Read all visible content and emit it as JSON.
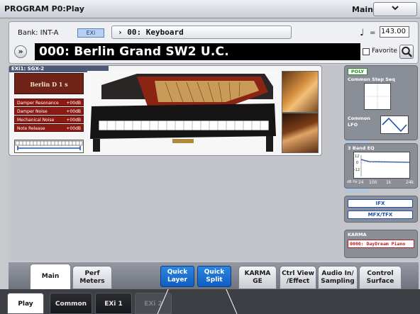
{
  "title_bar": {
    "title": "PROGRAM P0:Play",
    "mode_label": "Main",
    "mode_button_glyph": "⌄"
  },
  "program": {
    "bank_label": "Bank:  INT-A",
    "exi_tag": "EXi",
    "program_select": "› 00: Keyboard",
    "tempo_icon": "♩",
    "tempo_eq": "=",
    "tempo_value": "143.00",
    "prev_glyph": "»",
    "program_name": "000: Berlin Grand SW2 U.C.",
    "favorite_label": "Favorite",
    "favorite_checked": false
  },
  "exi_panel": {
    "header": "EXi1: SGX-2",
    "plate": "Berlin D 1 s",
    "params": [
      {
        "name": "Damper Resonance",
        "value": "+00dB"
      },
      {
        "name": "Damper Noise",
        "value": "+00dB"
      },
      {
        "name": "Mechanical Noise",
        "value": "+00dB"
      },
      {
        "name": "Note Release",
        "value": "+00dB"
      }
    ]
  },
  "right_panel": {
    "poly_label": "POLY",
    "step_seq_label": "Common Step Seq",
    "lfo_label_1": "Common",
    "lfo_label_2": "LFO",
    "eq_title": "3 Band EQ",
    "eq_y_ticks": [
      "12",
      "0",
      "-12"
    ],
    "eq_x_ticks": [
      "24",
      "100",
      "1k",
      "24k"
    ],
    "eq_y_unit": "dB Hz",
    "ifx_label": "IFX",
    "mfx_label": "MFX/TFX",
    "karma_title": "KARMA",
    "karma_value": "0000: DayDream Piano"
  },
  "tabs": [
    {
      "label": "Main",
      "active": true
    },
    {
      "label": "Perf\nMeters",
      "active": false
    },
    {
      "label": "Quick\nLayer",
      "active": false,
      "style": "blue"
    },
    {
      "label": "Quick\nSplit",
      "active": false,
      "style": "blue"
    },
    {
      "label": "KARMA GE",
      "active": false
    },
    {
      "label": "Ctrl View\n/Effect",
      "active": false
    },
    {
      "label": "Audio In/\nSampling",
      "active": false
    },
    {
      "label": "Control\nSurface",
      "active": false
    }
  ],
  "page_tabs": [
    {
      "label": "Play",
      "active": true
    },
    {
      "label": "Common",
      "active": false
    },
    {
      "label": "EXi 1",
      "active": false
    },
    {
      "label": "EXi 2",
      "active": false,
      "disabled": true
    }
  ],
  "colors": {
    "accent_blue": "#1e6fd6",
    "param_red": "#8c1a12",
    "karma_red": "#b02020"
  }
}
